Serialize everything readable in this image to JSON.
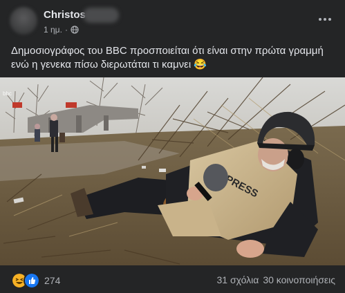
{
  "post": {
    "author": "Christos",
    "time": "1 ημ.",
    "separator": "·",
    "audience_icon": "globe-icon",
    "menu_icon": "more-dots-icon",
    "text": "Δημοσιογράφος του BBC προσποιείται ότι είναι στην πρώτα γραμμή ενώ η γενεκα πίσω διερωτάται τι καμνει 😂",
    "image_labels": {
      "vest": "PRESS",
      "watermark": "bbc"
    }
  },
  "footer": {
    "reaction_icons": [
      "laugh-reaction-icon",
      "like-reaction-icon"
    ],
    "reaction_count": "274",
    "comments": "31 σχόλια",
    "shares": "30 κοινοποιήσεις"
  },
  "colors": {
    "background": "#242526",
    "text": "#e4e6eb",
    "secondary_text": "#b0b3b8",
    "like_blue": "#1877f2",
    "haha_yellow": "#f7b125"
  }
}
